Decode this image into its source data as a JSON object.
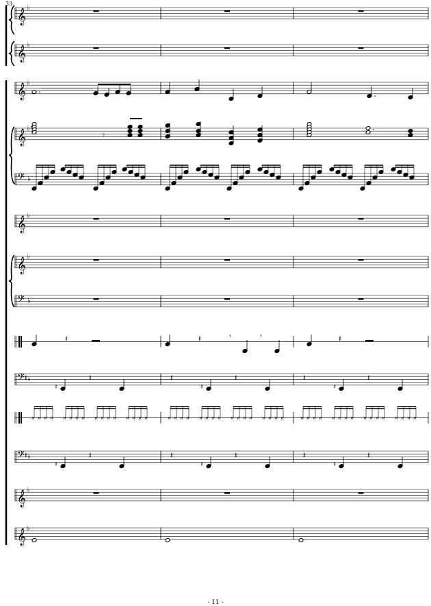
{
  "score": {
    "first_measure_number": "33",
    "page_number": "- 11 -",
    "measures_per_system": 3,
    "staves": [
      {
        "id": "staff-1",
        "clef": "treble",
        "key": "F major (1 flat)",
        "content": "rests"
      },
      {
        "id": "staff-2",
        "clef": "treble",
        "key": "F major (1 flat)",
        "content": "rests"
      },
      {
        "id": "staff-3",
        "clef": "treble",
        "key": "F major (1 flat)",
        "content": "melody"
      },
      {
        "id": "staff-4",
        "clef": "treble",
        "key": "F major (1 flat)",
        "content": "piano right hand chords"
      },
      {
        "id": "staff-5",
        "clef": "bass",
        "key": "F major (1 flat)",
        "content": "piano left hand arpeggios"
      },
      {
        "id": "staff-6",
        "clef": "treble",
        "key": "F major (1 flat)",
        "content": "rests"
      },
      {
        "id": "staff-7",
        "clef": "treble",
        "key": "F major (1 flat)",
        "content": "rests"
      },
      {
        "id": "staff-8",
        "clef": "bass",
        "key": "F major (1 flat)",
        "content": "rests"
      },
      {
        "id": "staff-9",
        "clef": "percussion",
        "key": "",
        "content": "percussion pattern"
      },
      {
        "id": "staff-10",
        "clef": "bass",
        "key": "F major (1 flat)",
        "content": "bass line"
      },
      {
        "id": "staff-11",
        "clef": "percussion",
        "key": "",
        "content": "sixteenth-note hi-hat"
      },
      {
        "id": "staff-12",
        "clef": "bass",
        "key": "F major (1 flat)",
        "content": "bass line"
      },
      {
        "id": "staff-13",
        "clef": "treble",
        "key": "F major (1 flat)",
        "content": "rests"
      },
      {
        "id": "staff-14",
        "clef": "treble",
        "key": "F major (1 flat)",
        "content": "whole notes"
      }
    ]
  },
  "colors": {
    "ink": "#000000",
    "paper": "#ffffff"
  }
}
